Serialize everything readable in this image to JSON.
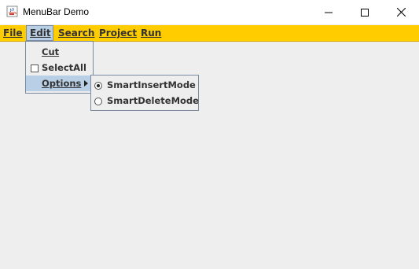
{
  "window": {
    "title": "MenuBar Demo",
    "icons": {
      "app": "java-cup-icon",
      "minimize": "minimize-icon",
      "maximize": "maximize-icon",
      "close": "close-icon"
    }
  },
  "menubar": {
    "accent": "#ffcc00",
    "menus": [
      {
        "label": "File"
      },
      {
        "label": "Edit"
      },
      {
        "label": "Search"
      },
      {
        "label": "Project"
      },
      {
        "label": "Run"
      }
    ]
  },
  "edit_menu": {
    "items": [
      {
        "label": "Cut"
      },
      {
        "label": "SelectAll",
        "checked": false
      },
      {
        "label": "Options"
      }
    ]
  },
  "options_menu": {
    "items": [
      {
        "label": "SmartInsertMode",
        "selected": true
      },
      {
        "label": "SmartDeleteMode",
        "selected": false
      }
    ]
  }
}
